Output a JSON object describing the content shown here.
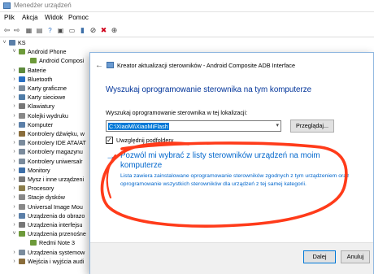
{
  "device_manager": {
    "title": "Menedżer urządzeń",
    "menu": [
      "Plik",
      "Akcja",
      "Widok",
      "Pomoc"
    ],
    "tree": [
      {
        "label": "KS",
        "level": 0,
        "expand": "v",
        "icon": "computer-icon",
        "color": "#5b7fa8"
      },
      {
        "label": "Android Phone",
        "level": 1,
        "expand": "v",
        "icon": "phone-icon",
        "color": "#6d9a3a"
      },
      {
        "label": "Android Composi",
        "level": 2,
        "expand": "",
        "icon": "phone-icon",
        "color": "#6d9a3a"
      },
      {
        "label": "Baterie",
        "level": 1,
        "expand": ">",
        "icon": "battery-icon",
        "color": "#5d8a3c"
      },
      {
        "label": "Bluetooth",
        "level": 1,
        "expand": ">",
        "icon": "bluetooth-icon",
        "color": "#2a6fc2"
      },
      {
        "label": "Karty graficzne",
        "level": 1,
        "expand": ">",
        "icon": "display-adapter-icon",
        "color": "#7a8b9c"
      },
      {
        "label": "Karty sieciowe",
        "level": 1,
        "expand": ">",
        "icon": "network-adapter-icon",
        "color": "#4f7ca8"
      },
      {
        "label": "Klawiatury",
        "level": 1,
        "expand": ">",
        "icon": "keyboard-icon",
        "color": "#777777"
      },
      {
        "label": "Kolejki wydruku",
        "level": 1,
        "expand": ">",
        "icon": "printer-icon",
        "color": "#888888"
      },
      {
        "label": "Komputer",
        "level": 1,
        "expand": ">",
        "icon": "computer-icon",
        "color": "#5b7fa8"
      },
      {
        "label": "Kontrolery dźwięku, w",
        "level": 1,
        "expand": ">",
        "icon": "sound-icon",
        "color": "#8a6d3b"
      },
      {
        "label": "Kontrolery IDE ATA/AT",
        "level": 1,
        "expand": ">",
        "icon": "ide-icon",
        "color": "#7a8b9c"
      },
      {
        "label": "Kontrolery magazynu",
        "level": 1,
        "expand": ">",
        "icon": "storage-icon",
        "color": "#7a8b9c"
      },
      {
        "label": "Kontrolery uniwersalr",
        "level": 1,
        "expand": ">",
        "icon": "usb-icon",
        "color": "#7a8b9c"
      },
      {
        "label": "Monitory",
        "level": 1,
        "expand": ">",
        "icon": "monitor-icon",
        "color": "#3d6fa8"
      },
      {
        "label": "Mysz i inne urządzeni",
        "level": 1,
        "expand": ">",
        "icon": "mouse-icon",
        "color": "#777777"
      },
      {
        "label": "Procesory",
        "level": 1,
        "expand": ">",
        "icon": "processor-icon",
        "color": "#8b7d4a"
      },
      {
        "label": "Stacje dysków",
        "level": 1,
        "expand": ">",
        "icon": "disk-icon",
        "color": "#888888"
      },
      {
        "label": "Universal Image Mou",
        "level": 1,
        "expand": ">",
        "icon": "drive-icon",
        "color": "#888888"
      },
      {
        "label": "Urządzenia do obrazo",
        "level": 1,
        "expand": ">",
        "icon": "camera-icon",
        "color": "#5b7fa8"
      },
      {
        "label": "Urządzenia interfejsu",
        "level": 1,
        "expand": ">",
        "icon": "hid-icon",
        "color": "#777777"
      },
      {
        "label": "Urządzenia przenośne",
        "level": 1,
        "expand": "v",
        "icon": "portable-device-icon",
        "color": "#6d9a3a"
      },
      {
        "label": "Redmi Note 3",
        "level": 2,
        "expand": "",
        "icon": "phone-icon",
        "color": "#6d9a3a"
      },
      {
        "label": "Urządzenia systemow",
        "level": 1,
        "expand": ">",
        "icon": "system-device-icon",
        "color": "#7a8b9c"
      },
      {
        "label": "Wejścia i wyjścia audi",
        "level": 1,
        "expand": ">",
        "icon": "audio-icon",
        "color": "#8a6d3b"
      }
    ]
  },
  "wizard": {
    "title": "Kreator aktualizacji sterowników - Android Composite ADB Interface",
    "heading": "Wyszukaj oprogramowanie sterownika na tym komputerze",
    "search_label": "Wyszukaj oprogramowanie sterownika w tej lokalizacji:",
    "path_value": "C:\\XiaoMi\\XiaoMiFlash",
    "browse_label": "Przeglądaj...",
    "include_subfolders_label": "Uwzględnij podfoldery",
    "include_subfolders_checked": true,
    "link_title": "Pozwól mi wybrać z listy sterowników urządzeń na moim komputerze",
    "link_description": "Lista zawiera zainstalowane oprogramowanie sterowników zgodnych z tym urządzeniem oraz oprogramowanie wszystkich sterowników dla urządzeń z tej samej kategorii.",
    "next_label": "Dalej",
    "cancel_label": "Anuluj"
  },
  "colors": {
    "heading_blue": "#003399",
    "link_blue": "#0066cc",
    "selection_blue": "#0078d7",
    "annotation_red": "#ff3b1a"
  }
}
